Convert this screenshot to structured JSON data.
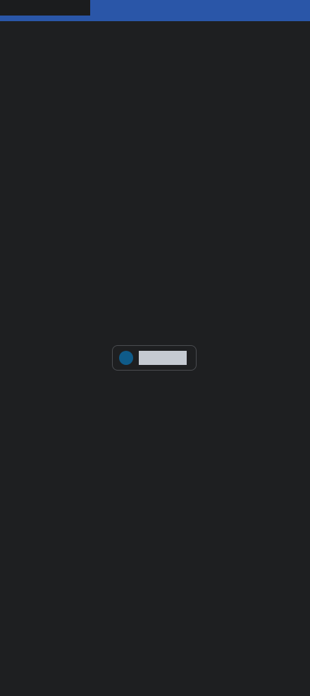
{
  "colors": {
    "background": "#1e1f21",
    "top_bar": "#2a56a8",
    "top_bar_left_segment": "#1b1c1e",
    "indicator_dot": "#0f5b89",
    "indicator_text_block": "#c5cad2",
    "border": "#4a4c50"
  },
  "loading_indicator": {
    "icon": "spinner-dot-icon",
    "label": ""
  }
}
